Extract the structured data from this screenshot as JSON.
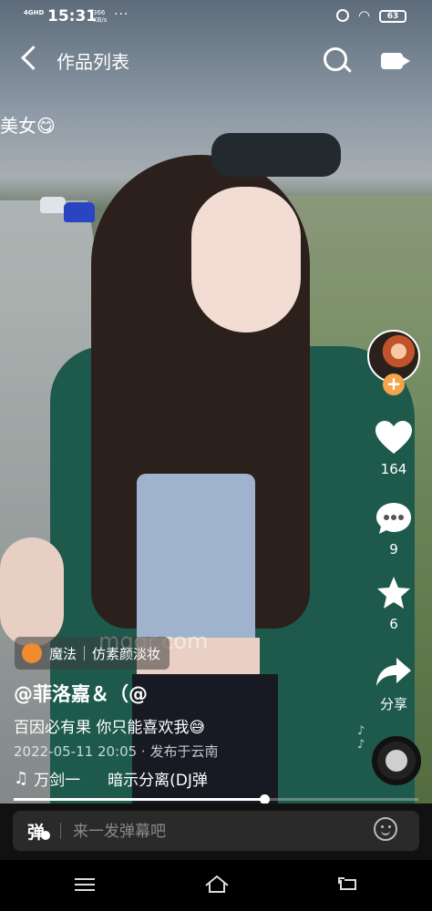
{
  "status_bar": {
    "network": "4GHD",
    "time": "15:31",
    "speed_value": "366",
    "speed_unit": "KB/s",
    "more": "···",
    "battery": "63"
  },
  "header": {
    "title": "作品列表"
  },
  "caption_partial": "美女😋",
  "rail": {
    "likes": "164",
    "comments": "9",
    "favorites": "6",
    "share_label": "分享"
  },
  "magic_tag": {
    "label": "魔法",
    "effect": "仿素颜淡妆"
  },
  "watermark": "mgqr.com",
  "post": {
    "author": "@菲洛嘉＆（@",
    "description": "百因必有果 你只能喜欢我😅",
    "meta": "2022-05-11 20:05 · 发布于云南",
    "music_1": "万剑一",
    "music_2": "暗示分离(DJ弹"
  },
  "progress": {
    "fraction": 0.62
  },
  "danmaku": {
    "toggle_label": "弹",
    "placeholder": "来一发弹幕吧"
  }
}
